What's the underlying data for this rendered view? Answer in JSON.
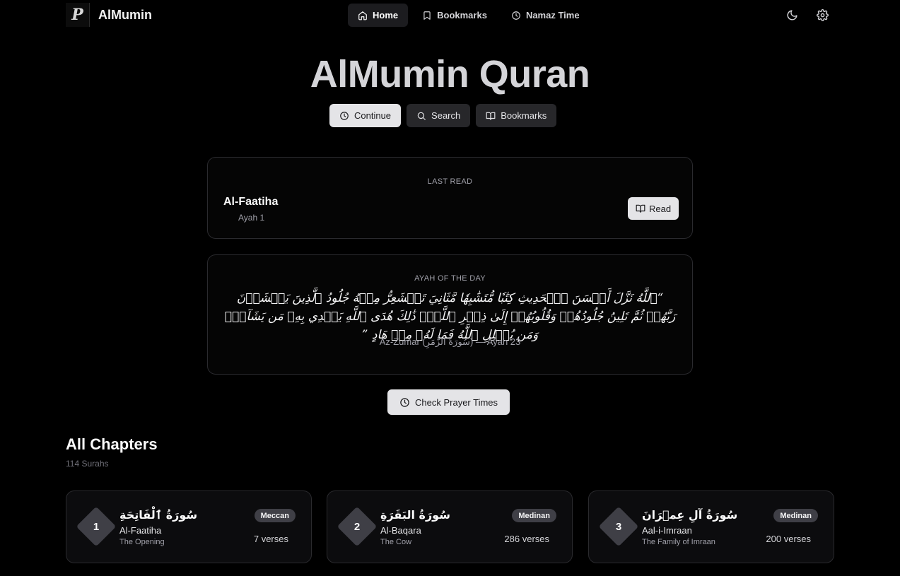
{
  "header": {
    "brand": "AlMumin",
    "logo_letter": "P",
    "nav": [
      {
        "label": "Home",
        "icon": "home-icon",
        "active": true
      },
      {
        "label": "Bookmarks",
        "icon": "bookmark-icon",
        "active": false
      },
      {
        "label": "Namaz Time",
        "icon": "clock-icon",
        "active": false
      }
    ]
  },
  "hero": {
    "title": "AlMumin Quran",
    "actions": [
      {
        "label": "Continue",
        "icon": "clock-icon"
      },
      {
        "label": "Search",
        "icon": "search-icon"
      },
      {
        "label": "Bookmarks",
        "icon": "book-open-icon"
      }
    ]
  },
  "last_read": {
    "label": "LAST READ",
    "surah": "Al-Faatiha",
    "ayah": "Ayah 1",
    "button": "Read"
  },
  "ayah_of_day": {
    "label": "AYAH OF THE DAY",
    "arabic": "“ٱللَّهُ نَزَّلَ أَحۡسَنَ ٱلۡحَدِيثِ كِتَٰبٗا مُّتَشَٰبِهٗا مَّثَانِيَ تَقۡشَعِرُّ مِنۡهُ جُلُودُ ٱلَّذِينَ يَخۡشَوۡنَ رَبَّهُمۡ ثُمَّ تَلِينُ جُلُودُهُمۡ وَقُلُوبُهُمۡ إِلَىٰ ذِكۡرِ ٱللَّهِۚ ذَٰلِكَ هُدَى ٱللَّهِ يَهۡدِي بِهِۦ مَن يَشَآءُۚ وَمَن يُضۡلِلِ ٱللَّهُ فَمَا لَهُۥ مِنۡ هَادٍ ”",
    "reference": "Az-Zumar (سُورَةُ الزُّمَرِ) — Ayah 23"
  },
  "prayer_button": "Check Prayer Times",
  "chapters": {
    "title": "All Chapters",
    "subtitle": "114 Surahs",
    "items": [
      {
        "number": "1",
        "arabic": "سُورَةُ ٱلْفَاتِحَةِ",
        "name": "Al-Faatiha",
        "translation": "The Opening",
        "type": "Meccan",
        "verses": "7 verses"
      },
      {
        "number": "2",
        "arabic": "سُورَةُ البَقَرَةِ",
        "name": "Al-Baqara",
        "translation": "The Cow",
        "type": "Medinan",
        "verses": "286 verses"
      },
      {
        "number": "3",
        "arabic": "سُورَةُ آلِ عِمۡرَانَ",
        "name": "Aal-i-Imraan",
        "translation": "The Family of Imraan",
        "type": "Medinan",
        "verses": "200 verses"
      }
    ]
  }
}
